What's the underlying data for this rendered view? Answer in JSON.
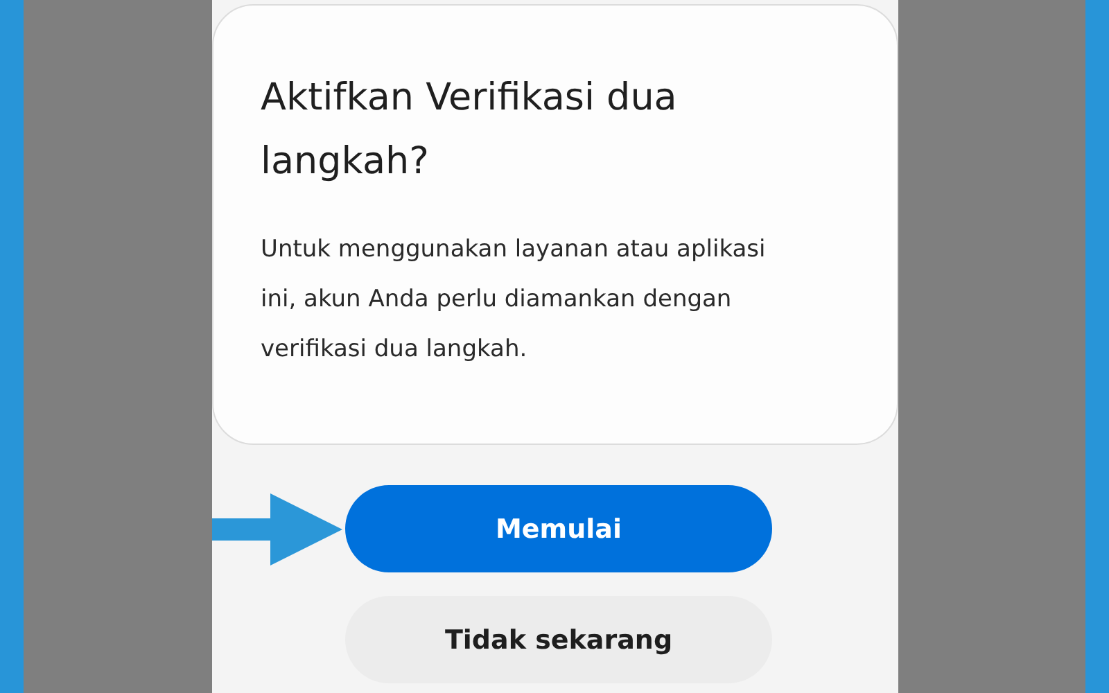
{
  "dialog": {
    "title": "Aktifkan Verifikasi dua langkah?",
    "message": "Untuk menggunakan layanan atau aplikasi ini, akun Anda perlu diamankan dengan verifikasi dua langkah."
  },
  "buttons": [
    {
      "label": "Memulai",
      "kind": "primary",
      "pointed_at": true
    },
    {
      "label": "Tidak sekarang",
      "kind": "secondary",
      "pointed_at": false
    }
  ]
}
